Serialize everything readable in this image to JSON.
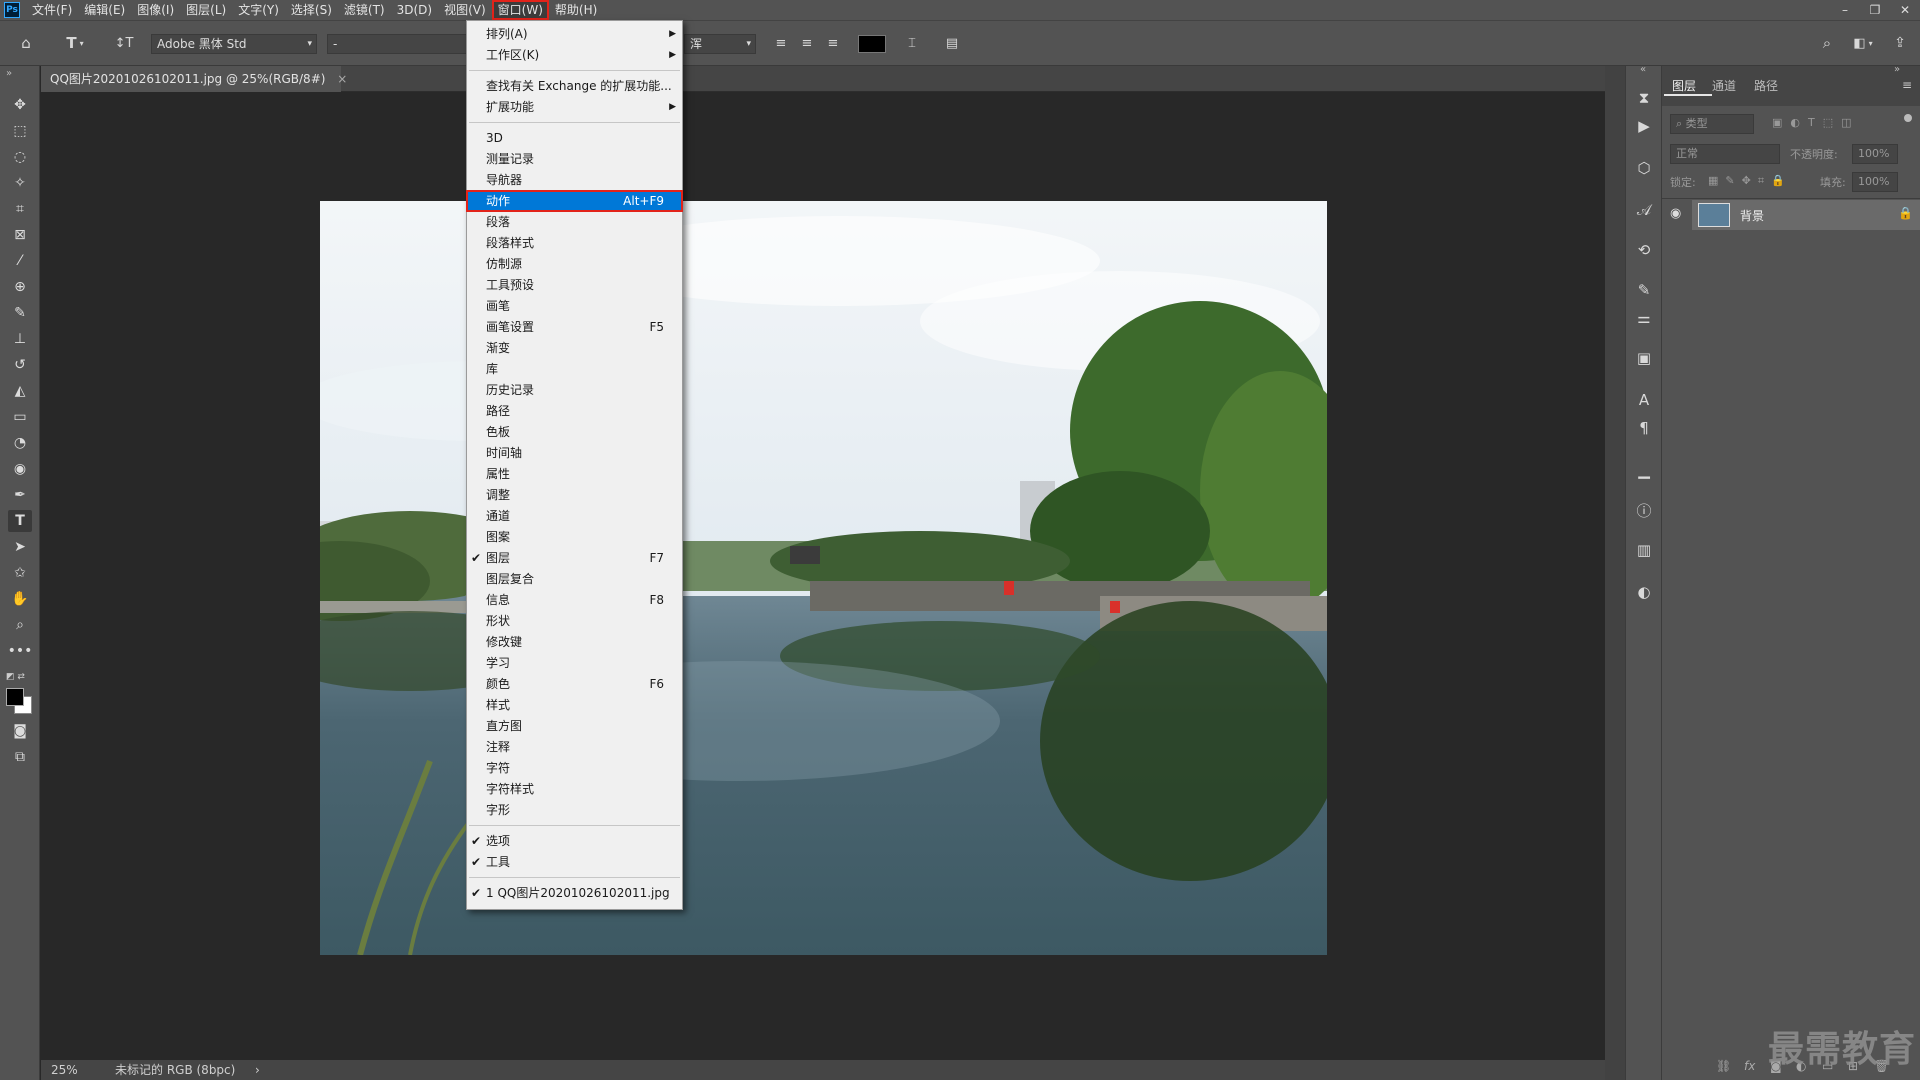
{
  "app": {
    "logo": "Ps"
  },
  "menubar": {
    "items": [
      "文件(F)",
      "编辑(E)",
      "图像(I)",
      "图层(L)",
      "文字(Y)",
      "选择(S)",
      "滤镜(T)",
      "3D(D)",
      "视图(V)",
      "窗口(W)",
      "帮助(H)"
    ],
    "active_index": 9,
    "window_controls": [
      "–",
      "❐",
      "✕"
    ]
  },
  "options_bar": {
    "font_family": "Adobe 黑体 Std",
    "font_style": "-",
    "anti_alias_partial": "浑",
    "color_swatch": "#000000"
  },
  "document": {
    "tab_title": "QQ图片20201026102011.jpg @ 25%(RGB/8#)",
    "tab_close": "×"
  },
  "status": {
    "zoom": "25%",
    "doc_info": "未标记的 RGB (8bpc)",
    "arrow": "›"
  },
  "layers_panel": {
    "tabs": [
      "图层",
      "通道",
      "路径"
    ],
    "active_tab": 0,
    "filter_placeholder": "类型",
    "blend_mode": "正常",
    "opacity_label": "不透明度:",
    "opacity_value": "100%",
    "lock_label": "锁定:",
    "fill_label": "填充:",
    "fill_value": "100%",
    "layers": [
      {
        "name": "背景",
        "visible": true,
        "locked": true
      }
    ]
  },
  "window_menu": {
    "items": [
      {
        "label": "排列(A)",
        "submenu": true
      },
      {
        "label": "工作区(K)",
        "submenu": true
      },
      {
        "sep": true
      },
      {
        "label": "查找有关 Exchange 的扩展功能..."
      },
      {
        "label": "扩展功能",
        "submenu": true
      },
      {
        "sep": true
      },
      {
        "label": "3D"
      },
      {
        "label": "测量记录"
      },
      {
        "label": "导航器"
      },
      {
        "label": "动作",
        "shortcut": "Alt+F9",
        "highlighted": true
      },
      {
        "label": "段落"
      },
      {
        "label": "段落样式"
      },
      {
        "label": "仿制源"
      },
      {
        "label": "工具预设"
      },
      {
        "label": "画笔"
      },
      {
        "label": "画笔设置",
        "shortcut": "F5"
      },
      {
        "label": "渐变"
      },
      {
        "label": "库"
      },
      {
        "label": "历史记录"
      },
      {
        "label": "路径"
      },
      {
        "label": "色板"
      },
      {
        "label": "时间轴"
      },
      {
        "label": "属性"
      },
      {
        "label": "调整"
      },
      {
        "label": "通道"
      },
      {
        "label": "图案"
      },
      {
        "label": "图层",
        "shortcut": "F7",
        "checked": true
      },
      {
        "label": "图层复合"
      },
      {
        "label": "信息",
        "shortcut": "F8"
      },
      {
        "label": "形状"
      },
      {
        "label": "修改键"
      },
      {
        "label": "学习"
      },
      {
        "label": "颜色",
        "shortcut": "F6"
      },
      {
        "label": "样式"
      },
      {
        "label": "直方图"
      },
      {
        "label": "注释"
      },
      {
        "label": "字符"
      },
      {
        "label": "字符样式"
      },
      {
        "label": "字形"
      },
      {
        "sep": true
      },
      {
        "label": "选项",
        "checked": true
      },
      {
        "label": "工具",
        "checked": true
      },
      {
        "sep": true
      },
      {
        "label": "1 QQ图片20201026102011.jpg",
        "checked": true
      }
    ]
  },
  "watermark": "最需教育",
  "colors": {
    "highlight": "#0078d7",
    "annotation_red": "#e2231a",
    "panel": "#535353",
    "canvas_bg": "#282828"
  }
}
